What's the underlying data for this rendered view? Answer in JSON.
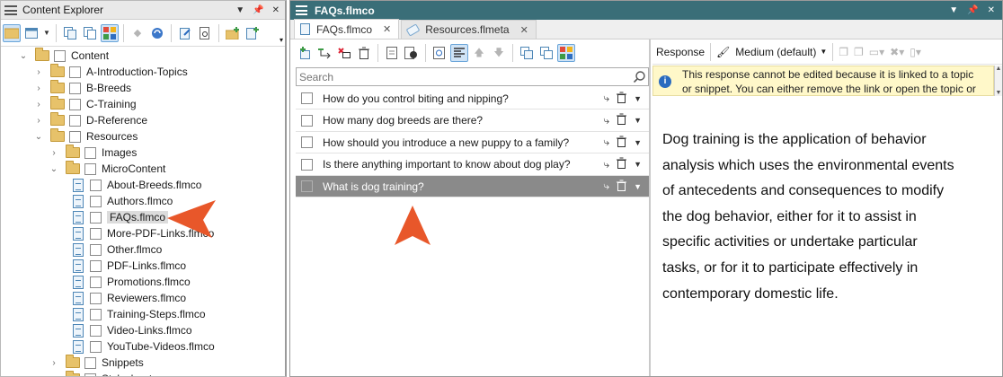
{
  "explorer": {
    "title": "Content Explorer",
    "tree": [
      {
        "label": "Content",
        "expanded": true,
        "type": "folder",
        "level": 0
      },
      {
        "label": "A-Introduction-Topics",
        "type": "folder",
        "level": 1
      },
      {
        "label": "B-Breeds",
        "type": "folder",
        "level": 1
      },
      {
        "label": "C-Training",
        "type": "folder",
        "level": 1
      },
      {
        "label": "D-Reference",
        "type": "folder",
        "level": 1
      },
      {
        "label": "Resources",
        "expanded": true,
        "type": "folder",
        "level": 1
      },
      {
        "label": "Images",
        "type": "folder",
        "level": 2
      },
      {
        "label": "MicroContent",
        "expanded": true,
        "type": "folder",
        "level": 2
      },
      {
        "label": "About-Breeds.flmco",
        "type": "file",
        "level": 3
      },
      {
        "label": "Authors.flmco",
        "type": "file",
        "level": 3
      },
      {
        "label": "FAQs.flmco",
        "type": "file",
        "level": 3,
        "selected": true
      },
      {
        "label": "More-PDF-Links.flmco",
        "type": "file",
        "level": 3
      },
      {
        "label": "Other.flmco",
        "type": "file",
        "level": 3
      },
      {
        "label": "PDF-Links.flmco",
        "type": "file",
        "level": 3
      },
      {
        "label": "Promotions.flmco",
        "type": "file",
        "level": 3
      },
      {
        "label": "Reviewers.flmco",
        "type": "file",
        "level": 3
      },
      {
        "label": "Training-Steps.flmco",
        "type": "file",
        "level": 3
      },
      {
        "label": "Video-Links.flmco",
        "type": "file",
        "level": 3
      },
      {
        "label": "YouTube-Videos.flmco",
        "type": "file",
        "level": 3
      },
      {
        "label": "Snippets",
        "type": "folder",
        "level": 2
      },
      {
        "label": "Stylesheets",
        "type": "folder",
        "level": 2
      }
    ]
  },
  "editor": {
    "title": "FAQs.flmco",
    "tabs": [
      {
        "label": "FAQs.flmco",
        "active": true
      },
      {
        "label": "Resources.flmeta",
        "active": false
      }
    ],
    "search": {
      "placeholder": "Search"
    },
    "faqs": [
      {
        "question": "How do you control biting and nipping?"
      },
      {
        "question": "How many dog breeds are there?"
      },
      {
        "question": "How should you introduce a new puppy to a family?"
      },
      {
        "question": "Is there anything important to know about dog play?"
      },
      {
        "question": "What is dog training?",
        "highlighted": true
      }
    ]
  },
  "response": {
    "label": "Response",
    "size_label": "Medium (default)",
    "info_message": "This response cannot be edited because it is linked to a topic\nor snippet. You can either remove the link or open the topic or",
    "body": "Dog training is the application of behavior\nanalysis which uses the environmental events\nof antecedents and consequences to modify\nthe dog behavior, either for it to assist in\nspecific activities or undertake particular\ntasks, or for it to participate effectively in\ncontemporary domestic life."
  },
  "colors": {
    "title_bar": "#3a6e78",
    "highlight_row": "#8a8a8a",
    "callout_arrow": "#e8572a",
    "info_bg": "#fff8c9"
  }
}
